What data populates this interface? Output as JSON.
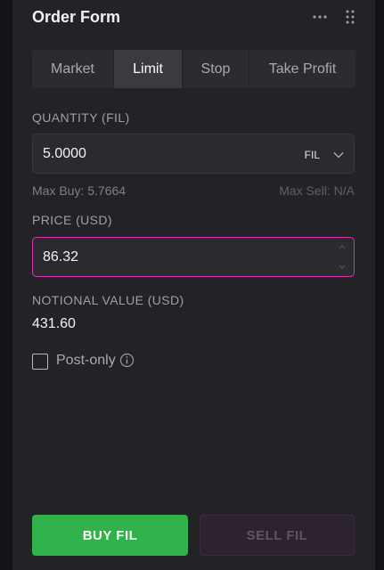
{
  "header": {
    "title": "Order Form",
    "more_icon": "ellipsis-icon",
    "drag_icon": "drag-handle-icon"
  },
  "tabs": [
    {
      "label": "Market",
      "active": false
    },
    {
      "label": "Limit",
      "active": true
    },
    {
      "label": "Stop",
      "active": false
    },
    {
      "label": "Take Profit",
      "active": false
    }
  ],
  "quantity": {
    "label": "QUANTITY (FIL)",
    "value": "5.0000",
    "unit": "FIL",
    "max_buy": "Max Buy: 5.7664",
    "max_sell": "Max Sell: N/A"
  },
  "price": {
    "label": "PRICE (USD)",
    "value": "86.32"
  },
  "notional": {
    "label": "NOTIONAL VALUE (USD)",
    "value": "431.60"
  },
  "post_only": {
    "label": "Post-only",
    "checked": false
  },
  "actions": {
    "buy_label": "BUY FIL",
    "sell_label": "SELL FIL"
  },
  "colors": {
    "buy": "#2fb34a",
    "sell_disabled": "#2c2230",
    "focus_border": "#d633b3",
    "panel": "#232327"
  }
}
